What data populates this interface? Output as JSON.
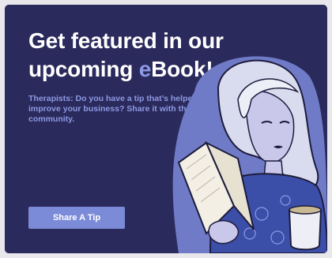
{
  "banner": {
    "headline_line1": "Get featured in our",
    "headline_prefix": "upcoming ",
    "headline_accent": "e",
    "headline_suffix": "Book!",
    "subtext": "Therapists: Do you have a tip that’s helped you improve your business?  Share it with the community.",
    "cta_label": "Share A Tip",
    "illustration_name": "woman-reading-book-illustration"
  },
  "colors": {
    "background": "#2b2a5c",
    "accent": "#8d99e3",
    "button": "#7c8bd8",
    "headline": "#ffffff"
  }
}
